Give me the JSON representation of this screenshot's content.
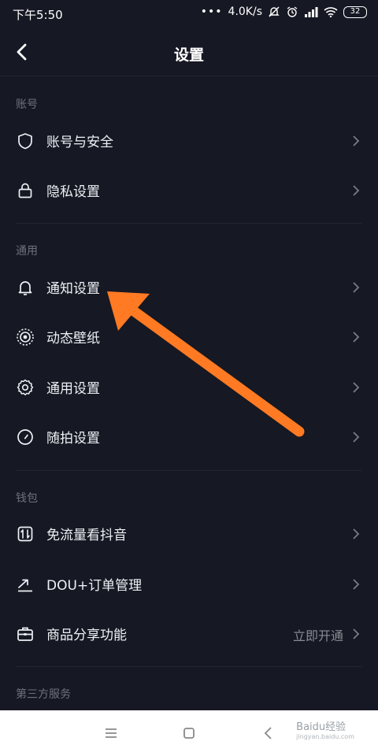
{
  "status_bar": {
    "time": "下午5:50",
    "dots": "•••",
    "network_speed": "4.0K/s",
    "battery_level": "32"
  },
  "header": {
    "title": "设置"
  },
  "sections": {
    "account": {
      "title": "账号",
      "items": [
        {
          "label": "账号与安全",
          "icon": "shield-icon"
        },
        {
          "label": "隐私设置",
          "icon": "lock-icon"
        }
      ]
    },
    "general": {
      "title": "通用",
      "items": [
        {
          "label": "通知设置",
          "icon": "bell-icon"
        },
        {
          "label": "动态壁纸",
          "icon": "wallpaper-icon"
        },
        {
          "label": "通用设置",
          "icon": "gear-icon"
        },
        {
          "label": "随拍设置",
          "icon": "clock-icon"
        }
      ]
    },
    "wallet": {
      "title": "钱包",
      "items": [
        {
          "label": "免流量看抖音",
          "icon": "data-plan-icon"
        },
        {
          "label": "DOU+订单管理",
          "icon": "trend-icon"
        },
        {
          "label": "商品分享功能",
          "icon": "briefcase-icon",
          "value": "立即开通"
        }
      ]
    },
    "third_party": {
      "title": "第三方服务"
    }
  },
  "annotation": {
    "type": "arrow",
    "color": "#ff7a22",
    "target": "通知设置"
  },
  "watermark": {
    "text": "Baidu经验",
    "subtext": "jingyan.baidu.com"
  },
  "colors": {
    "background": "#161823",
    "text": "#eef0f5",
    "muted": "#6f717a",
    "nav_bar": "#ffffff"
  }
}
